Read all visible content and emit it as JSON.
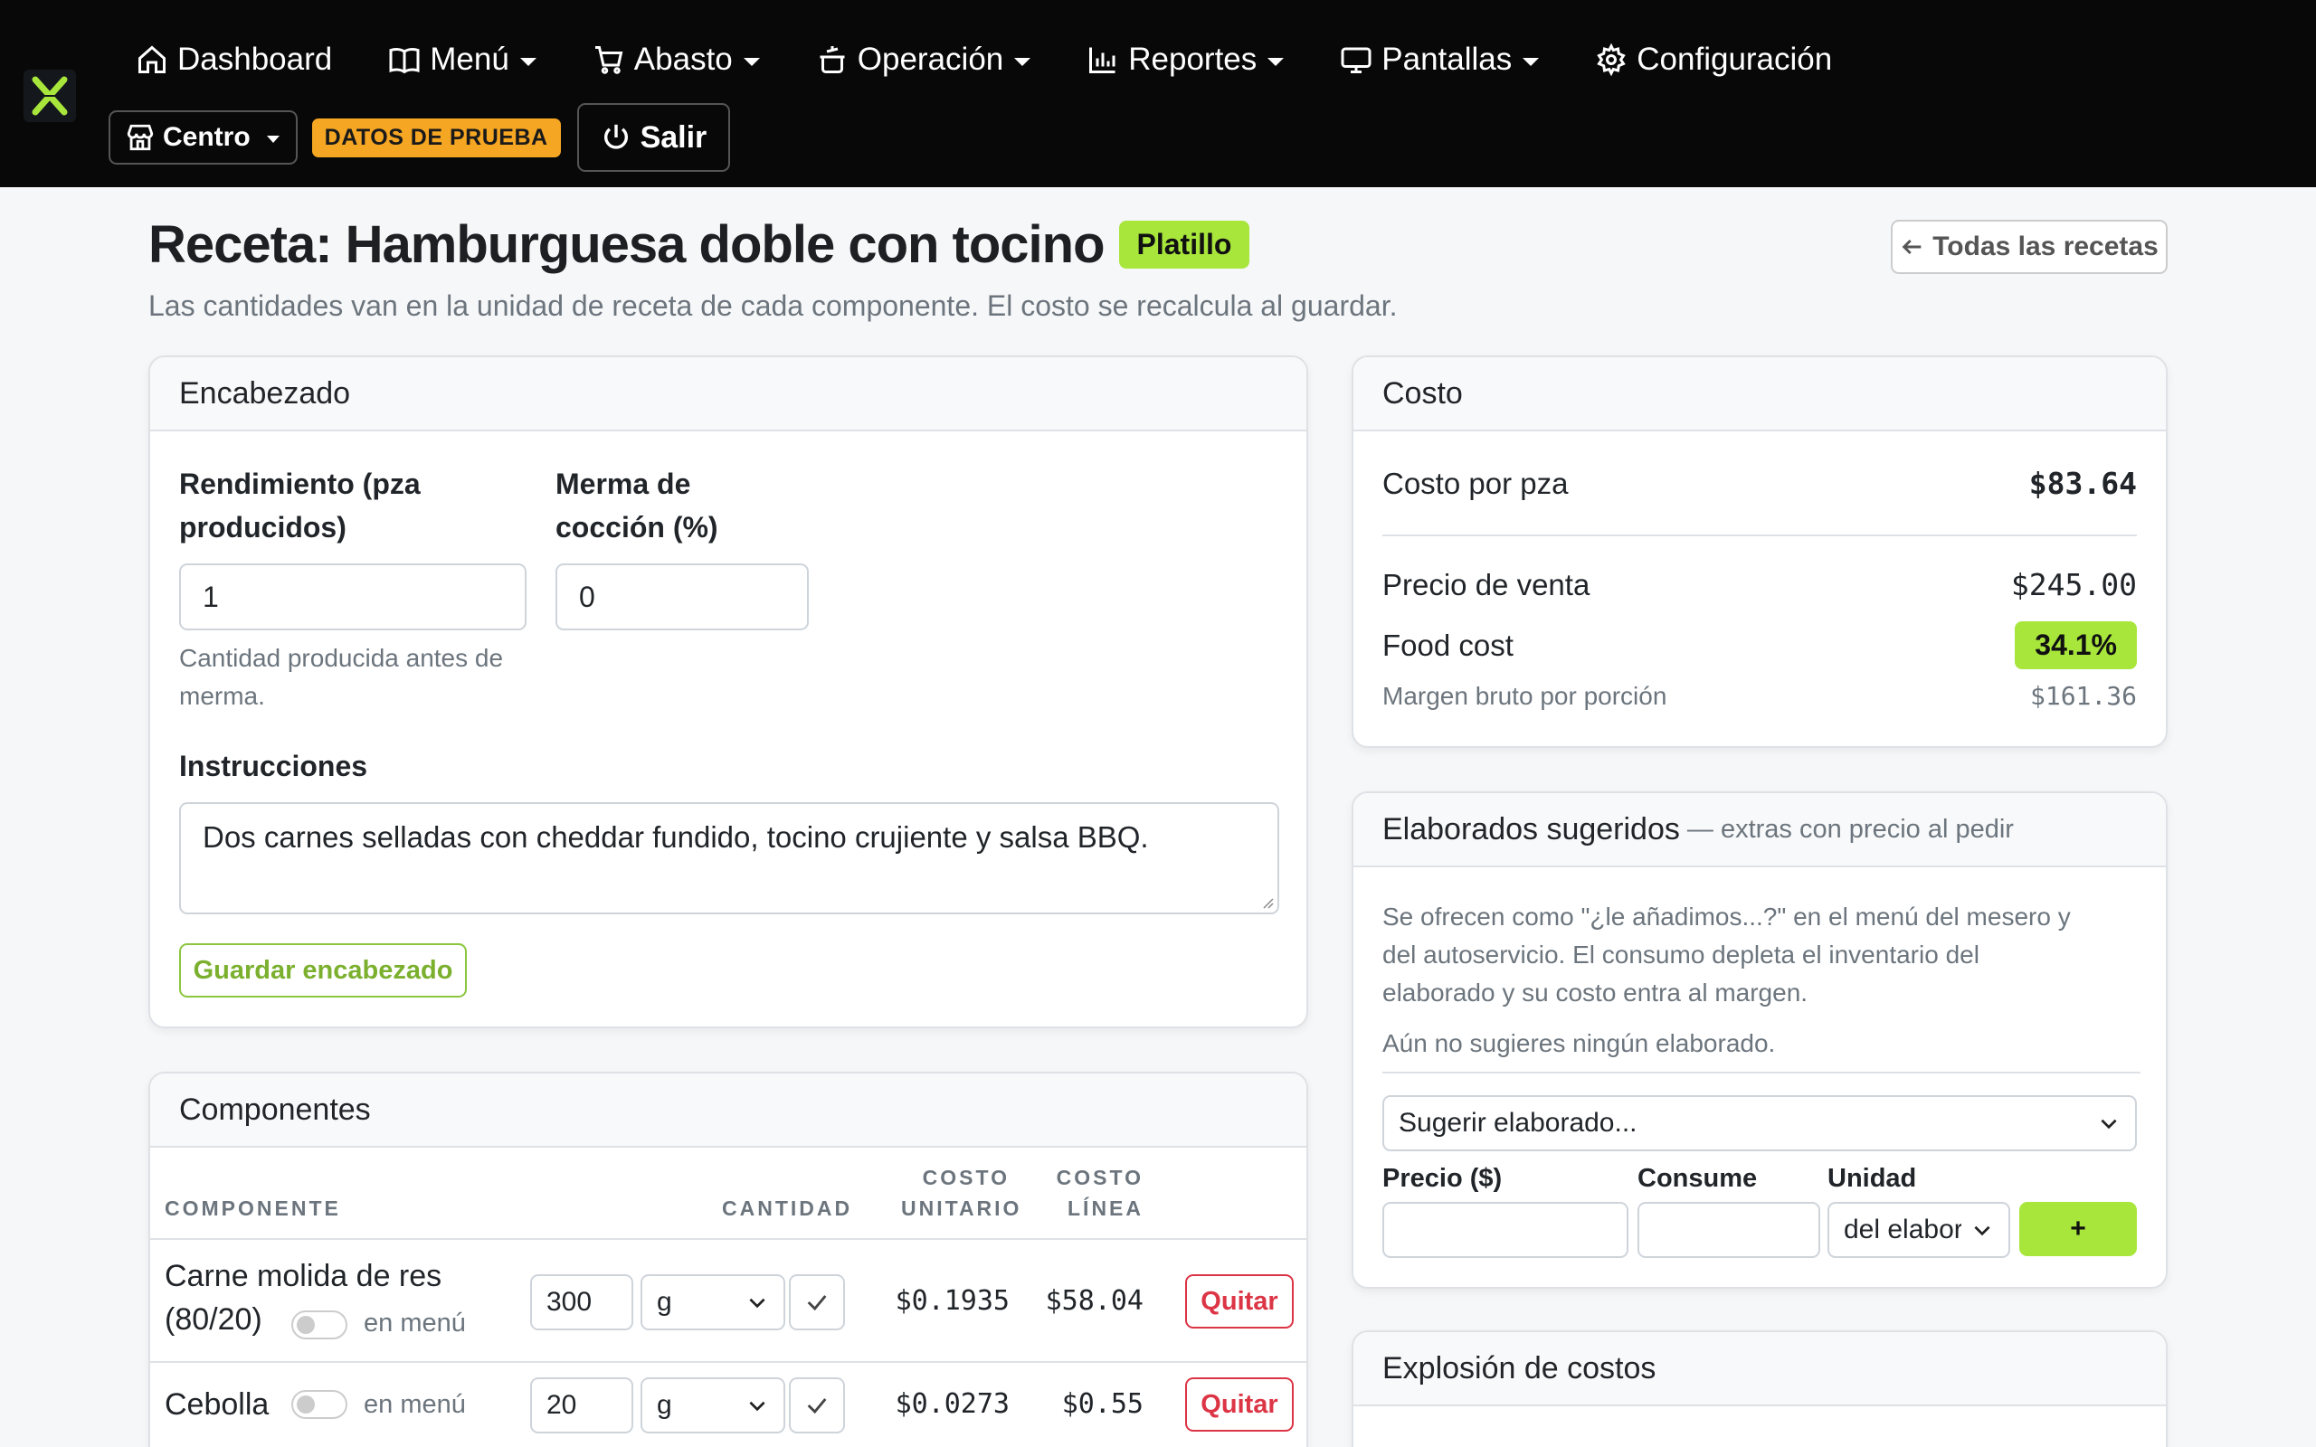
{
  "nav": {
    "items": [
      {
        "label": "Dashboard",
        "icon": "home-icon",
        "caret": false
      },
      {
        "label": "Menú",
        "icon": "book-icon",
        "caret": true
      },
      {
        "label": "Abasto",
        "icon": "cart-icon",
        "caret": true
      },
      {
        "label": "Operación",
        "icon": "pot-icon",
        "caret": true
      },
      {
        "label": "Reportes",
        "icon": "bar-chart-icon",
        "caret": true
      },
      {
        "label": "Pantallas",
        "icon": "monitor-icon",
        "caret": true
      },
      {
        "label": "Configuración",
        "icon": "gear-icon",
        "caret": false
      }
    ],
    "location": "Centro",
    "test_badge": "DATOS DE PRUEBA",
    "exit_label": "Salir"
  },
  "header": {
    "title": "Receta: Hamburguesa doble con tocino",
    "type_badge": "Platillo",
    "subtitle": "Las cantidades van en la unidad de receta de cada componente. El costo se recalcula al guardar.",
    "back_label": "Todas las recetas"
  },
  "encabezado": {
    "title": "Encabezado",
    "rendimiento_label_1": "Rendimiento (pza",
    "rendimiento_label_2": "producidos)",
    "rendimiento_value": "1",
    "rendimiento_help_1": "Cantidad producida antes de",
    "rendimiento_help_2": "merma.",
    "merma_label_1": "Merma de",
    "merma_label_2": "cocción (%)",
    "merma_value": "0",
    "instrucciones_label": "Instrucciones",
    "instrucciones_value": "Dos carnes selladas con cheddar fundido, tocino crujiente y salsa BBQ.",
    "save_label": "Guardar encabezado"
  },
  "costo": {
    "title": "Costo",
    "costo_pza_label": "Costo por pza",
    "costo_pza_value": "$83.64",
    "precio_label": "Precio de venta",
    "precio_value": "$245.00",
    "food_cost_label": "Food cost",
    "food_cost_value": "34.1%",
    "margen_label": "Margen bruto por porción",
    "margen_value": "$161.36"
  },
  "sugeridos": {
    "title": "Elaborados sugeridos",
    "title_muted": "— extras con precio al pedir",
    "desc_1": "Se ofrecen como \"¿le añadimos...?\" en el menú del mesero y",
    "desc_2": "del autoservicio. El consumo depleta el inventario del",
    "desc_3": "elaborado y su costo entra al margen.",
    "empty": "Aún no sugieres ningún elaborado.",
    "select_placeholder": "Sugerir elaborado...",
    "precio_label": "Precio ($)",
    "consume_label": "Consume",
    "unidad_label": "Unidad",
    "unidad_value": "del elaborado",
    "add_label": "+"
  },
  "componentes": {
    "title": "Componentes",
    "headers": {
      "componente": "COMPONENTE",
      "cantidad": "CANTIDAD",
      "costo_unitario_1": "COSTO",
      "costo_unitario_2": "UNITARIO",
      "costo_linea_1": "COSTO",
      "costo_linea_2": "LÍNEA"
    },
    "rows": [
      {
        "name_1": "Carne molida de res",
        "name_2": "(80/20)",
        "menu_label": "en menú",
        "qty": "300",
        "unit": "g",
        "unit_cost": "$0.1935",
        "line_cost": "$58.04",
        "remove": "Quitar"
      },
      {
        "name_1": "Cebolla",
        "menu_label": "en menú",
        "qty": "20",
        "unit": "g",
        "unit_cost": "$0.0273",
        "line_cost": "$0.55",
        "remove": "Quitar"
      }
    ]
  },
  "explosion": {
    "title": "Explosión de costos"
  }
}
